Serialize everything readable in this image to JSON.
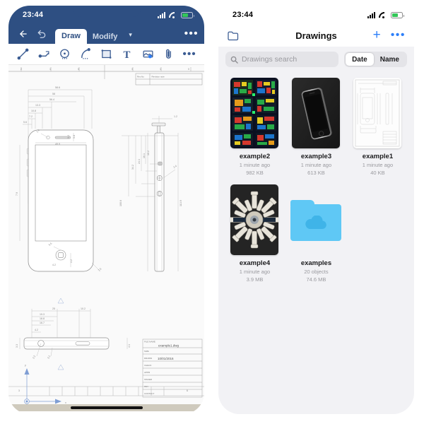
{
  "left_phone": {
    "status_bar": {
      "time": "23:44",
      "signal_icon": "cellular-signal-icon",
      "wifi_icon": "wifi-icon",
      "battery_icon": "battery-icon"
    },
    "topbar": {
      "back_icon": "back-arrow-icon",
      "undo_icon": "undo-icon",
      "more_label": "•••",
      "caret_label": "▾",
      "tabs": [
        {
          "label": "Draw",
          "active": true
        },
        {
          "label": "Modify",
          "active": false
        }
      ]
    },
    "toolbar": {
      "tools": [
        {
          "name": "line-tool",
          "label": "line"
        },
        {
          "name": "polyline-tool",
          "label": "polyline"
        },
        {
          "name": "circle-tool",
          "label": "circle"
        },
        {
          "name": "arc-tool",
          "label": "arc"
        },
        {
          "name": "rectangle-tool",
          "label": "rectangle"
        },
        {
          "name": "text-tool",
          "label": "T"
        },
        {
          "name": "image-tool",
          "label": "image"
        },
        {
          "name": "attach-tool",
          "label": "attach"
        },
        {
          "name": "more-tools",
          "label": "•••"
        }
      ]
    },
    "canvas": {
      "ruler_top_marks": [
        "2",
        "1",
        "5",
        "3",
        "1",
        "0"
      ],
      "ruler_bottom_marks": [
        "3",
        "6"
      ],
      "revision_block": {
        "col1": "Rev.No",
        "col2": "Revision note"
      },
      "title_block": {
        "file_name_label": "FILE NAME",
        "file_name": "example1.dwg",
        "size_label": "SIZE",
        "drawn_label": "DRAWN",
        "drawn_date": "10/01/2016",
        "check_label": "CHECK",
        "appr_label": "APPR",
        "issued_label": "ISSUED",
        "rev_label": "REV",
        "contact_label": "CONTACT"
      },
      "dimensions_top": [
        "58.6",
        "58",
        "56.4",
        "13.3",
        "10.8",
        "7.2",
        "5.6"
      ],
      "dimensions_front": [
        "49.9",
        "1.6",
        "5.8",
        "9.2",
        "5.6",
        "4.2",
        "7.6"
      ],
      "dimensions_side": [
        "113.9",
        "100.6",
        "34.2",
        "24.1",
        "16.1",
        "10.2",
        "1.2",
        "2.4"
      ],
      "dimensions_bottom": [
        "25",
        "19.3",
        "18.8",
        "16.7",
        "4.2",
        "3.3",
        "4.1"
      ]
    }
  },
  "right_phone": {
    "status_bar": {
      "time": "23:44",
      "signal_icon": "cellular-signal-icon",
      "wifi_icon": "wifi-icon",
      "battery_icon": "battery-icon"
    },
    "navbar": {
      "folder_icon": "folder-icon",
      "title": "Drawings",
      "add_label": "+",
      "more_label": "•••"
    },
    "search": {
      "placeholder": "Drawings search",
      "value": "",
      "icon": "search-icon"
    },
    "sort": {
      "options": [
        {
          "label": "Date",
          "active": true
        },
        {
          "label": "Name",
          "active": false
        }
      ]
    },
    "files": [
      {
        "name": "example2",
        "modified": "1 minute ago",
        "size": "982 KB",
        "thumb": "colorful-cad-sheets"
      },
      {
        "name": "example3",
        "modified": "1 minute ago",
        "size": "613 KB",
        "thumb": "black-phone-render"
      },
      {
        "name": "example1",
        "modified": "1 minute ago",
        "size": "40 KB",
        "thumb": "white-cad-drawing"
      },
      {
        "name": "example4",
        "modified": "1 minute ago",
        "size": "3.9 MB",
        "thumb": "dark-mechanical-render"
      },
      {
        "name": "examples",
        "modified": "20 objects",
        "size": "74.6 MB",
        "thumb": "blue-cloud-folder"
      }
    ]
  },
  "colors": {
    "app_blue": "#2e4f82",
    "ios_blue": "#2d7ff9",
    "folder_blue": "#5fc8f5",
    "panel_bg": "#f2f2f5",
    "battery_green": "#34c759"
  }
}
